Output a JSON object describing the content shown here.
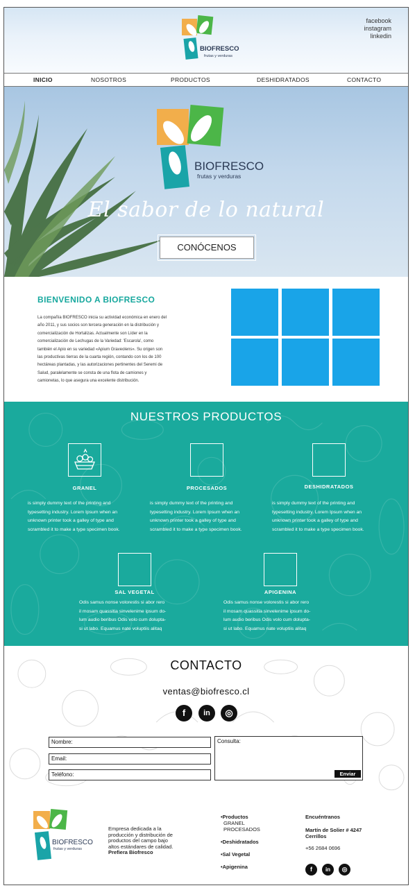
{
  "header": {
    "social_links": [
      "facebook",
      "instagram",
      "linkedin"
    ]
  },
  "brand": {
    "name": "BIOFRESCO",
    "subtitle": "frutas y verduras",
    "colors": {
      "orange": "#f2ae4b",
      "green": "#4cb648",
      "teal": "#1aa4a8",
      "blue": "#19a4e8",
      "teal_section": "#1aaa9d"
    }
  },
  "nav": {
    "items": [
      "INICIO",
      "NOSOTROS",
      "PRODUCTOS",
      "DESHIDRATADOS",
      "CONTACTO"
    ],
    "active": "INICIO"
  },
  "hero": {
    "tagline": "El sabor de lo natural",
    "button_label": "CONÓCENOS"
  },
  "welcome": {
    "title": "BIENVENIDO A BIOFRESCO",
    "lines": [
      "La compañía BIOFRESCO inicia su actividad económica en enero del",
      "año 2011, y sus socios son tercera generación en la distribución y",
      "comercialización de Hortalizas. Actualmente son Líder en la",
      "comercialización de Lechugas de la Variedad: 'Escarola', como",
      "también el Apio en su variedad «Apium Graveolens». Su origen son",
      "las productivas tierras de la cuarta región, contando con los de 100",
      "hectáreas plantadas, y las autorizaciones pertinentes del Seremi de",
      "Salud, paralelamente se consta de una flota de camiones y",
      "camionetas, lo que asegura una excelente distribución."
    ]
  },
  "products": {
    "title": "NUESTROS PRODUCTOS",
    "items": [
      {
        "name": "GRANEL",
        "lines": [
          "is simply dummy text of the printing and",
          "typesetting industry. Lorem Ipsum when an",
          "unknown printer took a galley of type and",
          "scrambled it to make a type specimen book."
        ]
      },
      {
        "name": "PROCESADOS",
        "lines": [
          "is simply dummy text of the printing and",
          "typesetting industry. Lorem Ipsum when an",
          "unknown printer took a galley of type and",
          "scrambled it to make a type specimen book."
        ]
      },
      {
        "name": "DESHIDRATADOS",
        "lines": [
          "is simply dummy text of the printing and",
          "typesetting industry. Lorem Ipsum when an",
          "unknown printer took a galley of type and",
          "scrambled it to make a type specimen book."
        ]
      },
      {
        "name": "SAL VEGETAL",
        "lines": [
          "Odis samus nonse volorestis si abor rero",
          "il mosam quassitia sinvelenime ipsum do-",
          "lum audio beribus Odis volo cum dolupta-",
          "si ut labo. Equamus nate voluptiis alitaq"
        ]
      },
      {
        "name": "APIGENINA",
        "lines": [
          "Odis samus nonse volorestis si abor rero",
          "il mosam quassitia sinvelenime ipsum do-",
          "lum audio beribus Odis volo cum dolupta-",
          "si ut labo. Equamus nate voluptiis alitaq"
        ]
      }
    ]
  },
  "contact": {
    "title": "CONTACTO",
    "email": "ventas@biofresco.cl",
    "social_icons": [
      "facebook-icon",
      "linkedin-icon",
      "instagram-icon"
    ],
    "social_glyphs": [
      "f",
      "in",
      "◎"
    ],
    "form": {
      "name_label": "Nombre:",
      "email_label": "Email:",
      "phone_label": "Teléfono:",
      "message_label": "Consulta:",
      "send_label": "Enviar"
    }
  },
  "footer": {
    "description_lines": [
      "Empresa dedicada a la",
      "producción y distribución de",
      "productos del campo bajo",
      "altos estándares de calidad."
    ],
    "description_strong": "Prefiera Biofresco",
    "links": {
      "productos": "•Productos",
      "granel": "GRANEL",
      "procesados": "PROCESADOS",
      "deshidratados": "•Deshidratados",
      "sal_vegetal": "•Sal Vegetal",
      "apigenina": "•Apigenina"
    },
    "find_us": {
      "title": "Encuéntranos",
      "address_line1": "Martín de Solier # 4247",
      "address_line2": "Cerrillos",
      "phone": "+56 2684 0696"
    }
  }
}
